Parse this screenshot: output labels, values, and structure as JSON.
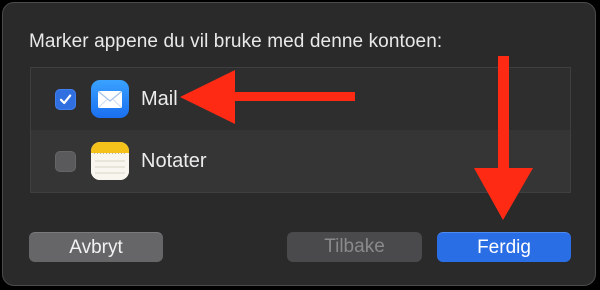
{
  "dialog": {
    "prompt": "Marker appene du vil bruke med denne kontoen:",
    "apps": [
      {
        "label": "Mail",
        "checked": true,
        "icon": "mail-icon"
      },
      {
        "label": "Notater",
        "checked": false,
        "icon": "notes-icon"
      }
    ],
    "buttons": {
      "cancel": "Avbryt",
      "back": "Tilbake",
      "done": "Ferdig"
    }
  },
  "annotations": {
    "arrow_color": "#ff2a14"
  },
  "colors": {
    "accent": "#2a6ee6",
    "background": "#2a2a2b"
  }
}
